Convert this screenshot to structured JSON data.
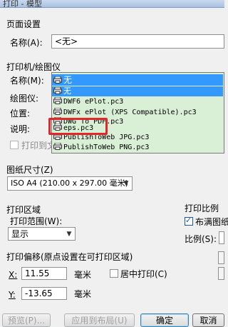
{
  "window": {
    "title": "打印 - 模型"
  },
  "page_setup": {
    "section": "页面设置",
    "name_label": "名称(A):",
    "name_value": "<无>"
  },
  "printer": {
    "section": "打印机/绘图仪",
    "name_label": "名称(M):",
    "name_value": "无",
    "plotter_label": "绘图仪:",
    "location_label": "位置:",
    "description_label": "说明:",
    "print_to_file_label": "打印到文",
    "options": [
      "无",
      "DWF6 ePlot.pc3",
      "DWFx ePlot (XPS Compatible).pc3",
      "DWG To PDF.pc3",
      "eps.pc3",
      "PublishToWeb JPG.pc3",
      "PublishToWeb PNG.pc3"
    ]
  },
  "paper_size": {
    "label": "图纸尺寸(Z)",
    "value": "ISO A4 (210.00 x 297.00 毫米)"
  },
  "plot_area": {
    "section": "打印区域",
    "range_label": "打印范围(W):",
    "range_value": "显示"
  },
  "plot_scale": {
    "section": "打印比例",
    "fit_label": "布满图纸",
    "fit_checked": true,
    "scale_label": "比例(S):"
  },
  "plot_offset": {
    "section": "打印偏移(原点设置在可打印区域)",
    "x_label": "X:",
    "x_value": "11.55",
    "x_unit": "毫米",
    "y_label": "Y:",
    "y_value": "-13.65",
    "y_unit": "毫米",
    "center_label": "居中打印(C)",
    "center_checked": false
  },
  "buttons": {
    "preview": "预览(P)...",
    "apply_layout": "应用到布局(U)",
    "ok": "确定",
    "cancel": "取消"
  },
  "colors": {
    "selection": "#3399ff",
    "list_bg": "#d9efd6",
    "highlight_box": "#e3262b"
  }
}
